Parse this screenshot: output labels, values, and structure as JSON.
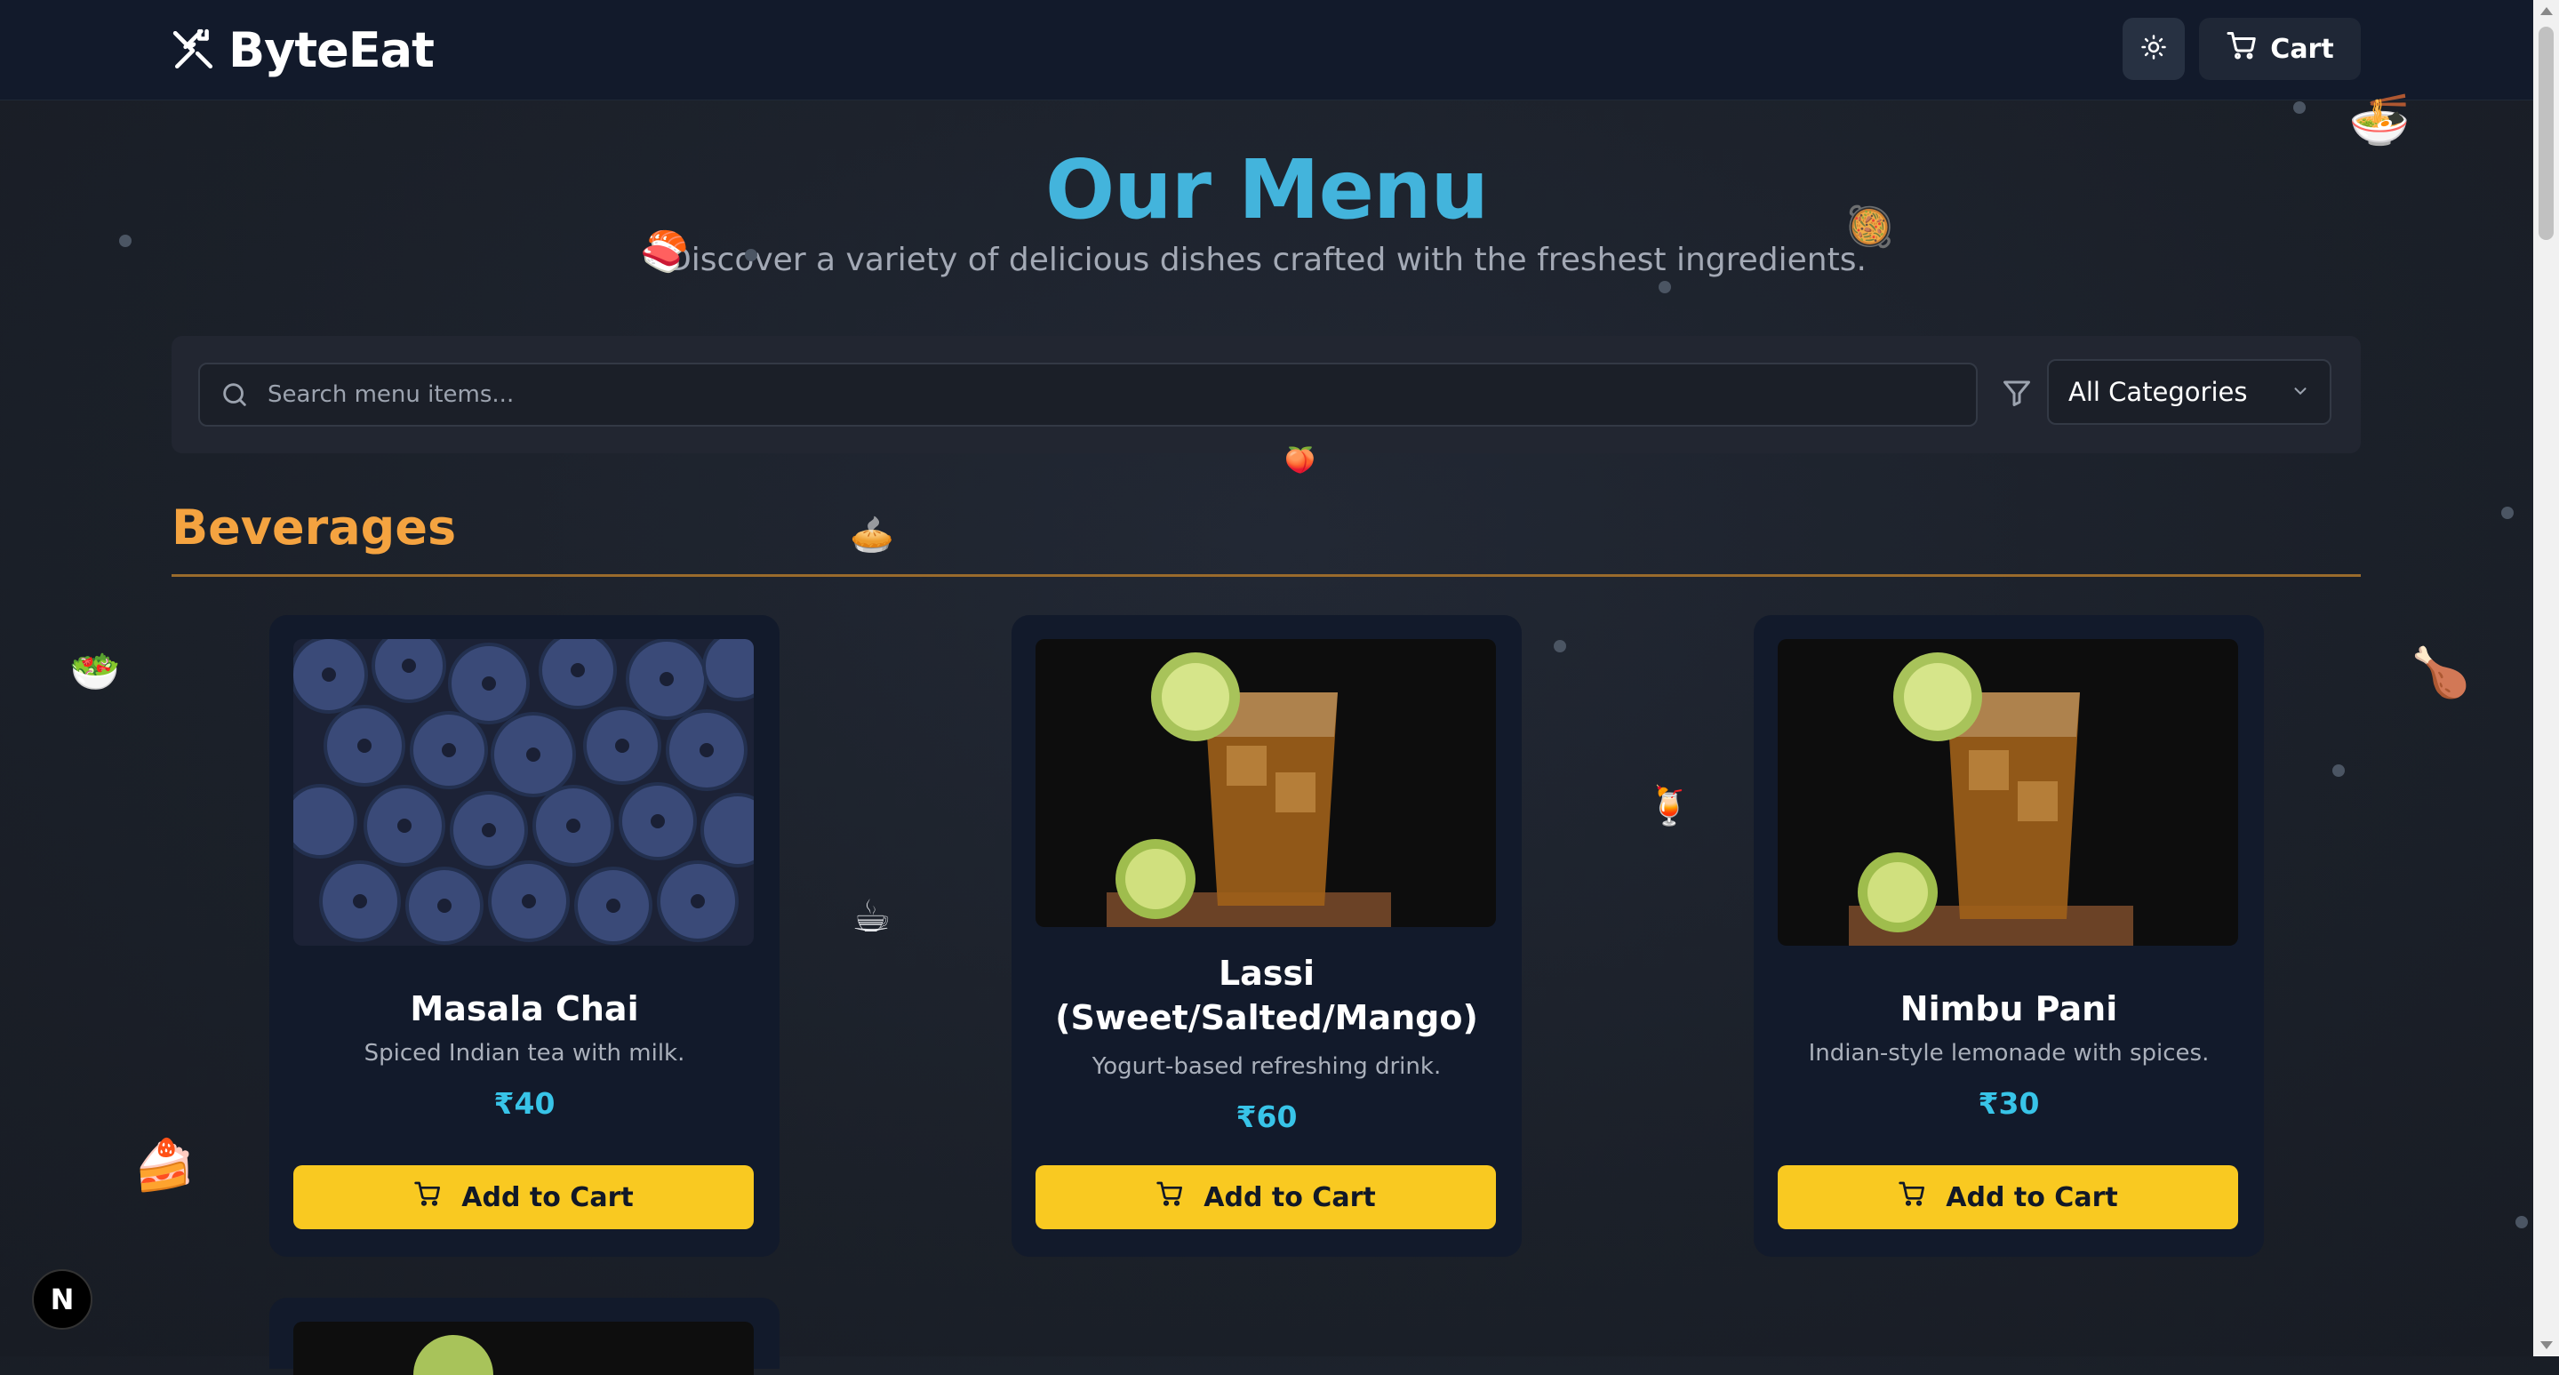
{
  "brand": {
    "name": "ByteEat",
    "icon": "utensils-crossed-icon"
  },
  "header": {
    "theme_toggle_icon": "sun-icon",
    "cart_label": "Cart",
    "cart_icon": "cart-icon"
  },
  "hero": {
    "title": "Our Menu",
    "subtitle": "Discover a variety of delicious dishes crafted with the freshest ingredients."
  },
  "filters": {
    "search_placeholder": "Search menu items...",
    "search_icon": "search-icon",
    "filter_icon": "filter-icon",
    "category_selected": "All Categories"
  },
  "section": {
    "title": "Beverages"
  },
  "items": [
    {
      "name": "Masala Chai",
      "description": "Spiced Indian tea with milk.",
      "price": "₹40",
      "button": "Add to Cart",
      "image": "blueberries"
    },
    {
      "name": "Lassi (Sweet/Salted/Mango)",
      "description": "Yogurt-based refreshing drink.",
      "price": "₹60",
      "button": "Add to Cart",
      "image": "iced-tea-glass"
    },
    {
      "name": "Nimbu Pani",
      "description": "Indian-style lemonade with spices.",
      "price": "₹30",
      "button": "Add to Cart",
      "image": "iced-tea-glass"
    }
  ],
  "floating_emojis": [
    "🍜",
    "🥘",
    "🍣",
    "🥗",
    "🍗",
    "🍹",
    "☕",
    "🥧",
    "🍰",
    "🍑"
  ],
  "dev_badge": "N",
  "colors": {
    "background": "#1c212b",
    "header": "#121a2b",
    "title": "#43b4dc",
    "section": "#f4a340",
    "price": "#38c4e8",
    "button": "#f9c921"
  }
}
